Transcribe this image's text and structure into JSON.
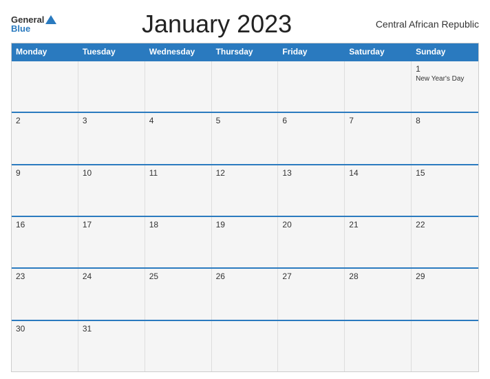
{
  "logo": {
    "general": "General",
    "blue": "Blue"
  },
  "title": "January 2023",
  "country": "Central African Republic",
  "header_days": [
    "Monday",
    "Tuesday",
    "Wednesday",
    "Thursday",
    "Friday",
    "Saturday",
    "Sunday"
  ],
  "weeks": [
    [
      {
        "day": "",
        "event": ""
      },
      {
        "day": "",
        "event": ""
      },
      {
        "day": "",
        "event": ""
      },
      {
        "day": "",
        "event": ""
      },
      {
        "day": "",
        "event": ""
      },
      {
        "day": "",
        "event": ""
      },
      {
        "day": "1",
        "event": "New Year's Day"
      }
    ],
    [
      {
        "day": "2",
        "event": ""
      },
      {
        "day": "3",
        "event": ""
      },
      {
        "day": "4",
        "event": ""
      },
      {
        "day": "5",
        "event": ""
      },
      {
        "day": "6",
        "event": ""
      },
      {
        "day": "7",
        "event": ""
      },
      {
        "day": "8",
        "event": ""
      }
    ],
    [
      {
        "day": "9",
        "event": ""
      },
      {
        "day": "10",
        "event": ""
      },
      {
        "day": "11",
        "event": ""
      },
      {
        "day": "12",
        "event": ""
      },
      {
        "day": "13",
        "event": ""
      },
      {
        "day": "14",
        "event": ""
      },
      {
        "day": "15",
        "event": ""
      }
    ],
    [
      {
        "day": "16",
        "event": ""
      },
      {
        "day": "17",
        "event": ""
      },
      {
        "day": "18",
        "event": ""
      },
      {
        "day": "19",
        "event": ""
      },
      {
        "day": "20",
        "event": ""
      },
      {
        "day": "21",
        "event": ""
      },
      {
        "day": "22",
        "event": ""
      }
    ],
    [
      {
        "day": "23",
        "event": ""
      },
      {
        "day": "24",
        "event": ""
      },
      {
        "day": "25",
        "event": ""
      },
      {
        "day": "26",
        "event": ""
      },
      {
        "day": "27",
        "event": ""
      },
      {
        "day": "28",
        "event": ""
      },
      {
        "day": "29",
        "event": ""
      }
    ],
    [
      {
        "day": "30",
        "event": ""
      },
      {
        "day": "31",
        "event": ""
      },
      {
        "day": "",
        "event": ""
      },
      {
        "day": "",
        "event": ""
      },
      {
        "day": "",
        "event": ""
      },
      {
        "day": "",
        "event": ""
      },
      {
        "day": "",
        "event": ""
      }
    ]
  ]
}
